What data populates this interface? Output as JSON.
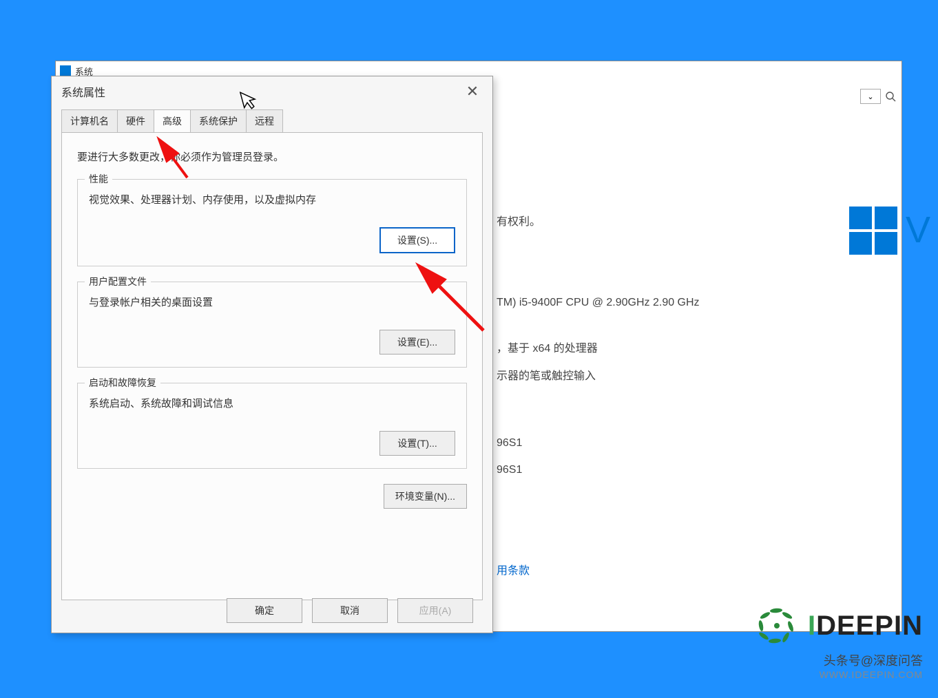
{
  "back_window": {
    "title": "系统",
    "rights": "有权利。",
    "cpu": "TM) i5-9400F CPU @ 2.90GHz   2.90 GHz",
    "arch": "，基于 x64 的处理器",
    "touch": "示器的笔或触控输入",
    "id1": "96S1",
    "id2": "96S1",
    "terms": "用条款"
  },
  "dialog": {
    "title": "系统属性",
    "tabs": {
      "computer_name": "计算机名",
      "hardware": "硬件",
      "advanced": "高级",
      "system_protection": "系统保护",
      "remote": "远程"
    },
    "intro": "要进行大多数更改，你必须作为管理员登录。",
    "performance": {
      "title": "性能",
      "desc": "视觉效果、处理器计划、内存使用，以及虚拟内存",
      "button": "设置(S)..."
    },
    "profiles": {
      "title": "用户配置文件",
      "desc": "与登录帐户相关的桌面设置",
      "button": "设置(E)..."
    },
    "startup": {
      "title": "启动和故障恢复",
      "desc": "系统启动、系统故障和调试信息",
      "button": "设置(T)..."
    },
    "env_button": "环境变量(N)...",
    "ok": "确定",
    "cancel": "取消",
    "apply": "应用(A)"
  },
  "watermark": {
    "brand": "DEEPIN",
    "sub": "头条号@深度问答",
    "url": "WWW.IDEEPIN.COM"
  }
}
